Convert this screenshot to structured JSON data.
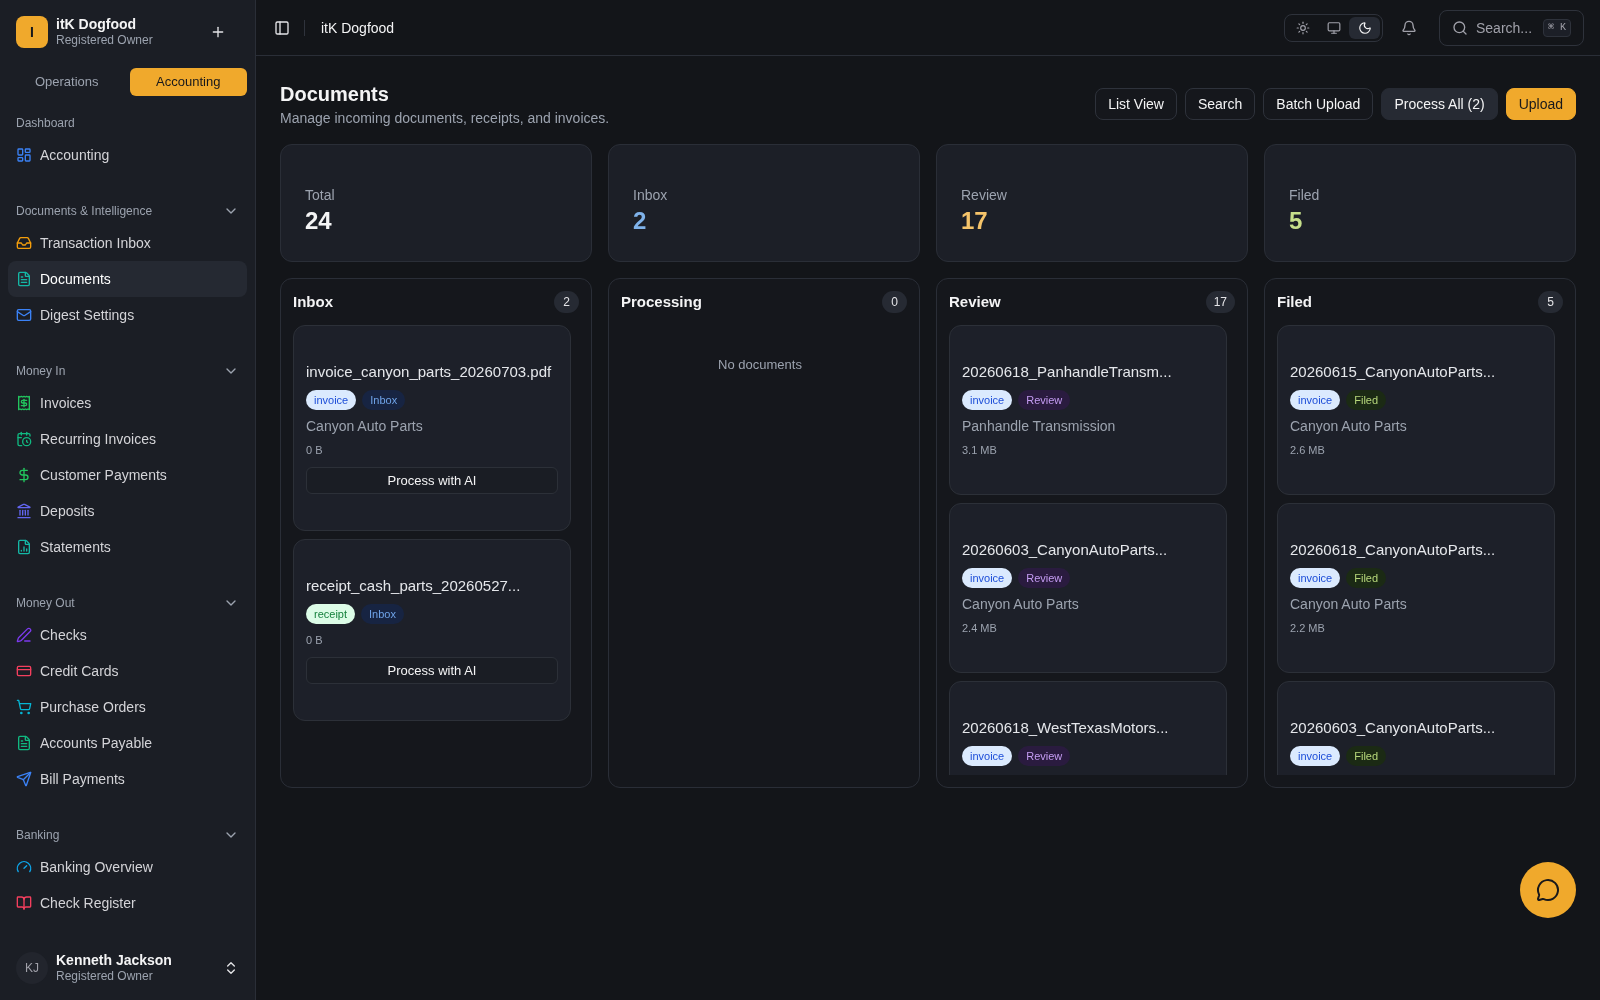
{
  "sidebar": {
    "workspace": {
      "initial": "I",
      "name": "itK Dogfood",
      "role": "Registered Owner"
    },
    "mode_tabs": [
      {
        "label": "Operations",
        "selected": false
      },
      {
        "label": "Accounting",
        "selected": true
      }
    ],
    "dashboard": {
      "title": "Dashboard",
      "items": [
        {
          "label": "Accounting",
          "selected": false
        }
      ]
    },
    "groups": [
      {
        "title": "Documents & Intelligence",
        "expanded": true,
        "items": [
          {
            "label": "Transaction Inbox",
            "selected": false
          },
          {
            "label": "Documents",
            "selected": true
          },
          {
            "label": "Digest Settings",
            "selected": false
          }
        ]
      },
      {
        "title": "Money In",
        "expanded": true,
        "items": [
          {
            "label": "Invoices",
            "selected": false
          },
          {
            "label": "Recurring Invoices",
            "selected": false
          },
          {
            "label": "Customer Payments",
            "selected": false
          },
          {
            "label": "Deposits",
            "selected": false
          },
          {
            "label": "Statements",
            "selected": false
          }
        ]
      },
      {
        "title": "Money Out",
        "expanded": true,
        "items": [
          {
            "label": "Checks",
            "selected": false
          },
          {
            "label": "Credit Cards",
            "selected": false
          },
          {
            "label": "Purchase Orders",
            "selected": false
          },
          {
            "label": "Accounts Payable",
            "selected": false
          },
          {
            "label": "Bill Payments",
            "selected": false
          }
        ]
      },
      {
        "title": "Banking",
        "expanded": true,
        "items": [
          {
            "label": "Banking Overview",
            "selected": false
          },
          {
            "label": "Check Register",
            "selected": false
          }
        ]
      }
    ],
    "user": {
      "initials": "KJ",
      "name": "Kenneth Jackson",
      "role": "Registered Owner"
    }
  },
  "top_bar": {
    "title": "itK Dogfood",
    "theme_options": [
      {
        "kind": "light",
        "selected": false
      },
      {
        "kind": "system",
        "selected": false
      },
      {
        "kind": "dark",
        "selected": true
      }
    ],
    "search": {
      "label": "Search...",
      "shortcut": "⌘ K"
    }
  },
  "page": {
    "title": "Documents",
    "subtitle": "Manage incoming documents, receipts, and invoices.",
    "actions": [
      {
        "label": "List View",
        "kind": "outline"
      },
      {
        "label": "Search",
        "kind": "outline"
      },
      {
        "label": "Batch Upload",
        "kind": "outline"
      },
      {
        "label": "Process All (2)",
        "kind": "secondary"
      },
      {
        "label": "Upload",
        "kind": "primary"
      }
    ]
  },
  "stats": [
    {
      "label": "Total",
      "value": "24",
      "color": "#f4f4f5"
    },
    {
      "label": "Inbox",
      "value": "2",
      "color": "#7fb2ea"
    },
    {
      "label": "Review",
      "value": "17",
      "color": "#f6c46a"
    },
    {
      "label": "Filed",
      "value": "5",
      "color": "#c6df8b"
    }
  ],
  "board": {
    "columns": [
      {
        "title": "Inbox",
        "count": "2",
        "cards": [
          {
            "name": "invoice_canyon_parts_20260703.pdf",
            "tags": [
              {
                "label": "invoice",
                "color": "#dbeafe"
              },
              {
                "label": "Inbox",
                "color": "#172442"
              }
            ],
            "vendor": "Canyon Auto Parts",
            "size": "0 B",
            "action": "Process with AI"
          },
          {
            "name": "receipt_cash_parts_20260527...",
            "tags": [
              {
                "label": "receipt",
                "color": "#dcfce7"
              },
              {
                "label": "Inbox",
                "color": "#172442"
              }
            ],
            "size": "0 B",
            "action": "Process with AI"
          }
        ]
      },
      {
        "title": "Processing",
        "count": "0",
        "empty_message": "No documents"
      },
      {
        "title": "Review",
        "count": "17",
        "cards": [
          {
            "name": "20260618_PanhandleTransm...",
            "tags": [
              {
                "label": "invoice",
                "color": "#dbeafe"
              },
              {
                "label": "Review",
                "color": "#2a1b3f"
              }
            ],
            "vendor": "Panhandle Transmission",
            "size": "3.1 MB"
          },
          {
            "name": "20260603_CanyonAutoParts...",
            "tags": [
              {
                "label": "invoice",
                "color": "#dbeafe"
              },
              {
                "label": "Review",
                "color": "#2a1b3f"
              }
            ],
            "vendor": "Canyon Auto Parts",
            "size": "2.4 MB"
          },
          {
            "name": "20260618_WestTexasMotors...",
            "tags": [
              {
                "label": "invoice",
                "color": "#dbeafe"
              },
              {
                "label": "Review",
                "color": "#2a1b3f"
              }
            ]
          }
        ]
      },
      {
        "title": "Filed",
        "count": "5",
        "cards": [
          {
            "name": "20260615_CanyonAutoParts...",
            "tags": [
              {
                "label": "invoice",
                "color": "#dbeafe"
              },
              {
                "label": "Filed",
                "color": "#1b2a14"
              }
            ],
            "vendor": "Canyon Auto Parts",
            "size": "2.6 MB"
          },
          {
            "name": "20260618_CanyonAutoParts...",
            "tags": [
              {
                "label": "invoice",
                "color": "#dbeafe"
              },
              {
                "label": "Filed",
                "color": "#1b2a14"
              }
            ],
            "vendor": "Canyon Auto Parts",
            "size": "2.2 MB"
          },
          {
            "name": "20260603_CanyonAutoParts...",
            "tags": [
              {
                "label": "invoice",
                "color": "#dbeafe"
              },
              {
                "label": "Filed",
                "color": "#1b2a14"
              }
            ]
          }
        ]
      }
    ]
  }
}
